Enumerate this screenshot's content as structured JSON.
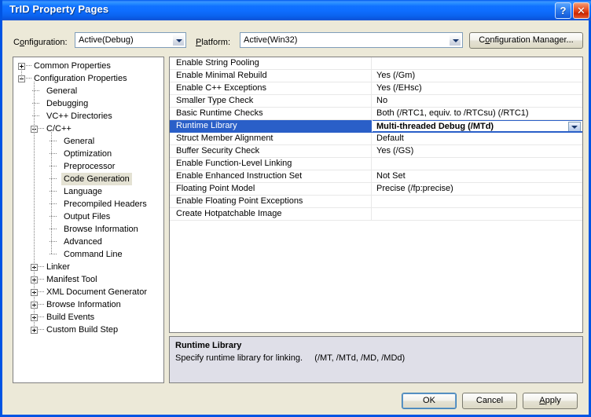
{
  "window": {
    "title": "TrID Property Pages",
    "help_button": "?",
    "close_button": "✕",
    "titlebar_gradient_start": "#0058ee",
    "titlebar_gradient_end": "#2a5fd8",
    "dialog_background": "#ece9d8",
    "frame_color": "#0054e3"
  },
  "toolbar": {
    "configuration_label_pre": "C",
    "configuration_label_accel": "o",
    "configuration_label_post": "nfiguration:",
    "configuration_value": "Active(Debug)",
    "platform_label_pre": "",
    "platform_label_accel": "P",
    "platform_label_post": "latform:",
    "platform_value": "Active(Win32)",
    "config_manager_pre": "C",
    "config_manager_accel": "o",
    "config_manager_post": "nfiguration Manager..."
  },
  "tree": {
    "selected": "Code Generation",
    "selection_background": "#e4e2d3",
    "items": [
      {
        "label": "Common Properties",
        "depth": 0,
        "expander": "plus",
        "selected": false
      },
      {
        "label": "Configuration Properties",
        "depth": 0,
        "expander": "minus",
        "selected": false
      },
      {
        "label": "General",
        "depth": 1,
        "expander": "none",
        "selected": false
      },
      {
        "label": "Debugging",
        "depth": 1,
        "expander": "none",
        "selected": false
      },
      {
        "label": "VC++ Directories",
        "depth": 1,
        "expander": "none",
        "selected": false
      },
      {
        "label": "C/C++",
        "depth": 1,
        "expander": "minus",
        "selected": false
      },
      {
        "label": "General",
        "depth": 2,
        "expander": "none",
        "selected": false
      },
      {
        "label": "Optimization",
        "depth": 2,
        "expander": "none",
        "selected": false
      },
      {
        "label": "Preprocessor",
        "depth": 2,
        "expander": "none",
        "selected": false
      },
      {
        "label": "Code Generation",
        "depth": 2,
        "expander": "none",
        "selected": true
      },
      {
        "label": "Language",
        "depth": 2,
        "expander": "none",
        "selected": false
      },
      {
        "label": "Precompiled Headers",
        "depth": 2,
        "expander": "none",
        "selected": false
      },
      {
        "label": "Output Files",
        "depth": 2,
        "expander": "none",
        "selected": false
      },
      {
        "label": "Browse Information",
        "depth": 2,
        "expander": "none",
        "selected": false
      },
      {
        "label": "Advanced",
        "depth": 2,
        "expander": "none",
        "selected": false
      },
      {
        "label": "Command Line",
        "depth": 2,
        "expander": "none",
        "selected": false
      },
      {
        "label": "Linker",
        "depth": 1,
        "expander": "plus",
        "selected": false
      },
      {
        "label": "Manifest Tool",
        "depth": 1,
        "expander": "plus",
        "selected": false
      },
      {
        "label": "XML Document Generator",
        "depth": 1,
        "expander": "plus",
        "selected": false
      },
      {
        "label": "Browse Information",
        "depth": 1,
        "expander": "plus",
        "selected": false
      },
      {
        "label": "Build Events",
        "depth": 1,
        "expander": "plus",
        "selected": false
      },
      {
        "label": "Custom Build Step",
        "depth": 1,
        "expander": "plus",
        "selected": false
      }
    ]
  },
  "grid": {
    "selection_background": "#2a5fc8",
    "selected_row_index": 5,
    "rows": [
      {
        "name": "Enable String Pooling",
        "value": ""
      },
      {
        "name": "Enable Minimal Rebuild",
        "value": "Yes (/Gm)"
      },
      {
        "name": "Enable C++ Exceptions",
        "value": "Yes (/EHsc)"
      },
      {
        "name": "Smaller Type Check",
        "value": "No"
      },
      {
        "name": "Basic Runtime Checks",
        "value": "Both (/RTC1, equiv. to /RTCsu) (/RTC1)"
      },
      {
        "name": "Runtime Library",
        "value": "Multi-threaded Debug (/MTd)",
        "selected": true,
        "dropdown": true
      },
      {
        "name": "Struct Member Alignment",
        "value": "Default"
      },
      {
        "name": "Buffer Security Check",
        "value": "Yes (/GS)"
      },
      {
        "name": "Enable Function-Level Linking",
        "value": ""
      },
      {
        "name": "Enable Enhanced Instruction Set",
        "value": "Not Set"
      },
      {
        "name": "Floating Point Model",
        "value": "Precise (/fp:precise)"
      },
      {
        "name": "Enable Floating Point Exceptions",
        "value": ""
      },
      {
        "name": "Create Hotpatchable Image",
        "value": ""
      }
    ]
  },
  "description": {
    "title": "Runtime Library",
    "body": "Specify runtime library for linking.     (/MT, /MTd, /MD, /MDd)",
    "background": "#dfdfe8"
  },
  "buttons": {
    "ok": "OK",
    "cancel": "Cancel",
    "apply_accel": "A",
    "apply_rest": "pply"
  }
}
